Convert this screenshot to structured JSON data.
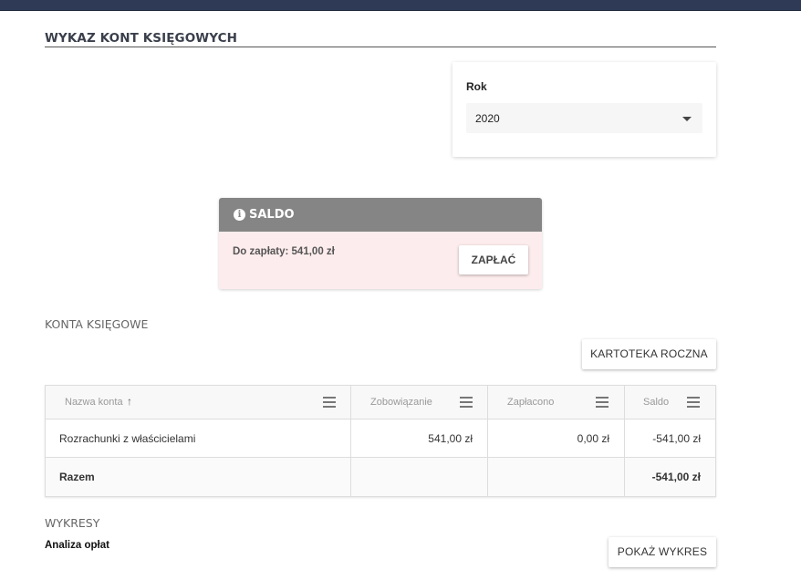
{
  "page": {
    "title": "WYKAZ KONT KSIĘGOWYCH"
  },
  "year_filter": {
    "label": "Rok",
    "value": "2020"
  },
  "saldo": {
    "title": "SALDO",
    "icon": "info-icon",
    "due_text": "Do zapłaty: 541,00 zł",
    "pay_label": "ZAPŁAĆ",
    "colors": {
      "header": "#858585",
      "body": "#fdeced"
    }
  },
  "accounts": {
    "section_title": "KONTA KSIĘGOWE",
    "annual_button": "KARTOTEKA ROCZNA",
    "columns": [
      "Nazwa konta",
      "Zobowiązanie",
      "Zapłacono",
      "Saldo"
    ],
    "sort_indicator": "↑",
    "rows": [
      {
        "name": "Rozrachunki z właścicielami",
        "obligation": "541,00 zł",
        "paid": "0,00 zł",
        "balance": "-541,00 zł"
      }
    ],
    "total": {
      "label": "Razem",
      "obligation": "",
      "paid": "",
      "balance": "-541,00 zł"
    }
  },
  "charts": {
    "section_title": "WYKRESY",
    "subtitle": "Analiza opłat",
    "show_button": "POKAŻ WYKRES"
  }
}
